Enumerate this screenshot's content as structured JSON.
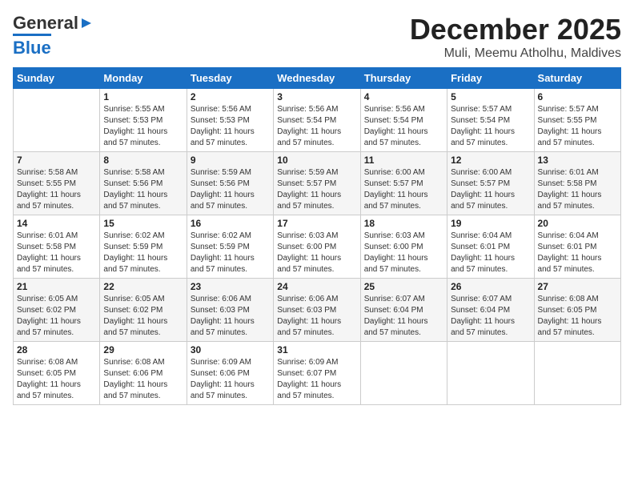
{
  "logo": {
    "general": "General",
    "blue": "Blue"
  },
  "title": "December 2025",
  "subtitle": "Muli, Meemu Atholhu, Maldives",
  "weekdays": [
    "Sunday",
    "Monday",
    "Tuesday",
    "Wednesday",
    "Thursday",
    "Friday",
    "Saturday"
  ],
  "weeks": [
    [
      {
        "day": "",
        "info": ""
      },
      {
        "day": "1",
        "info": "Sunrise: 5:55 AM\nSunset: 5:53 PM\nDaylight: 11 hours\nand 57 minutes."
      },
      {
        "day": "2",
        "info": "Sunrise: 5:56 AM\nSunset: 5:53 PM\nDaylight: 11 hours\nand 57 minutes."
      },
      {
        "day": "3",
        "info": "Sunrise: 5:56 AM\nSunset: 5:54 PM\nDaylight: 11 hours\nand 57 minutes."
      },
      {
        "day": "4",
        "info": "Sunrise: 5:56 AM\nSunset: 5:54 PM\nDaylight: 11 hours\nand 57 minutes."
      },
      {
        "day": "5",
        "info": "Sunrise: 5:57 AM\nSunset: 5:54 PM\nDaylight: 11 hours\nand 57 minutes."
      },
      {
        "day": "6",
        "info": "Sunrise: 5:57 AM\nSunset: 5:55 PM\nDaylight: 11 hours\nand 57 minutes."
      }
    ],
    [
      {
        "day": "7",
        "info": "Sunrise: 5:58 AM\nSunset: 5:55 PM\nDaylight: 11 hours\nand 57 minutes."
      },
      {
        "day": "8",
        "info": "Sunrise: 5:58 AM\nSunset: 5:56 PM\nDaylight: 11 hours\nand 57 minutes."
      },
      {
        "day": "9",
        "info": "Sunrise: 5:59 AM\nSunset: 5:56 PM\nDaylight: 11 hours\nand 57 minutes."
      },
      {
        "day": "10",
        "info": "Sunrise: 5:59 AM\nSunset: 5:57 PM\nDaylight: 11 hours\nand 57 minutes."
      },
      {
        "day": "11",
        "info": "Sunrise: 6:00 AM\nSunset: 5:57 PM\nDaylight: 11 hours\nand 57 minutes."
      },
      {
        "day": "12",
        "info": "Sunrise: 6:00 AM\nSunset: 5:57 PM\nDaylight: 11 hours\nand 57 minutes."
      },
      {
        "day": "13",
        "info": "Sunrise: 6:01 AM\nSunset: 5:58 PM\nDaylight: 11 hours\nand 57 minutes."
      }
    ],
    [
      {
        "day": "14",
        "info": "Sunrise: 6:01 AM\nSunset: 5:58 PM\nDaylight: 11 hours\nand 57 minutes."
      },
      {
        "day": "15",
        "info": "Sunrise: 6:02 AM\nSunset: 5:59 PM\nDaylight: 11 hours\nand 57 minutes."
      },
      {
        "day": "16",
        "info": "Sunrise: 6:02 AM\nSunset: 5:59 PM\nDaylight: 11 hours\nand 57 minutes."
      },
      {
        "day": "17",
        "info": "Sunrise: 6:03 AM\nSunset: 6:00 PM\nDaylight: 11 hours\nand 57 minutes."
      },
      {
        "day": "18",
        "info": "Sunrise: 6:03 AM\nSunset: 6:00 PM\nDaylight: 11 hours\nand 57 minutes."
      },
      {
        "day": "19",
        "info": "Sunrise: 6:04 AM\nSunset: 6:01 PM\nDaylight: 11 hours\nand 57 minutes."
      },
      {
        "day": "20",
        "info": "Sunrise: 6:04 AM\nSunset: 6:01 PM\nDaylight: 11 hours\nand 57 minutes."
      }
    ],
    [
      {
        "day": "21",
        "info": "Sunrise: 6:05 AM\nSunset: 6:02 PM\nDaylight: 11 hours\nand 57 minutes."
      },
      {
        "day": "22",
        "info": "Sunrise: 6:05 AM\nSunset: 6:02 PM\nDaylight: 11 hours\nand 57 minutes."
      },
      {
        "day": "23",
        "info": "Sunrise: 6:06 AM\nSunset: 6:03 PM\nDaylight: 11 hours\nand 57 minutes."
      },
      {
        "day": "24",
        "info": "Sunrise: 6:06 AM\nSunset: 6:03 PM\nDaylight: 11 hours\nand 57 minutes."
      },
      {
        "day": "25",
        "info": "Sunrise: 6:07 AM\nSunset: 6:04 PM\nDaylight: 11 hours\nand 57 minutes."
      },
      {
        "day": "26",
        "info": "Sunrise: 6:07 AM\nSunset: 6:04 PM\nDaylight: 11 hours\nand 57 minutes."
      },
      {
        "day": "27",
        "info": "Sunrise: 6:08 AM\nSunset: 6:05 PM\nDaylight: 11 hours\nand 57 minutes."
      }
    ],
    [
      {
        "day": "28",
        "info": "Sunrise: 6:08 AM\nSunset: 6:05 PM\nDaylight: 11 hours\nand 57 minutes."
      },
      {
        "day": "29",
        "info": "Sunrise: 6:08 AM\nSunset: 6:06 PM\nDaylight: 11 hours\nand 57 minutes."
      },
      {
        "day": "30",
        "info": "Sunrise: 6:09 AM\nSunset: 6:06 PM\nDaylight: 11 hours\nand 57 minutes."
      },
      {
        "day": "31",
        "info": "Sunrise: 6:09 AM\nSunset: 6:07 PM\nDaylight: 11 hours\nand 57 minutes."
      },
      {
        "day": "",
        "info": ""
      },
      {
        "day": "",
        "info": ""
      },
      {
        "day": "",
        "info": ""
      }
    ]
  ]
}
